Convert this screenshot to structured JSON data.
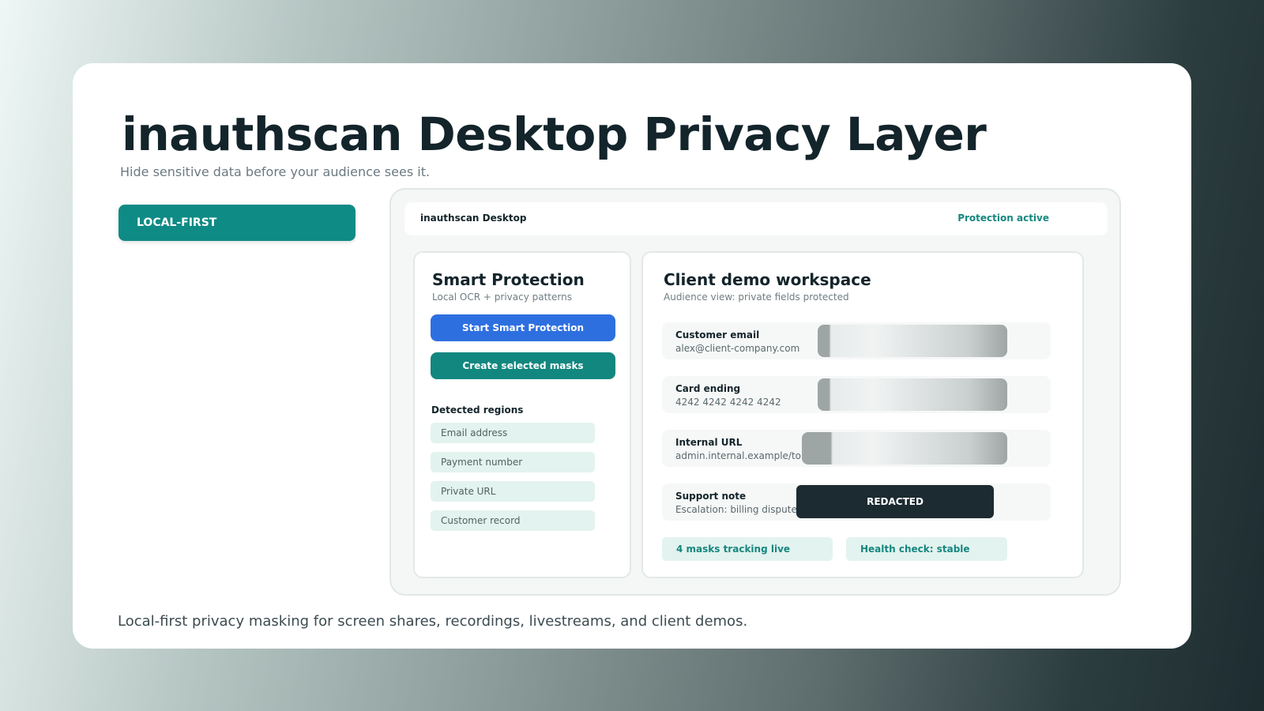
{
  "hero": {
    "title": "inauthscan Desktop Privacy Layer",
    "subtitle": "Hide sensitive data before your audience sees it.",
    "badge": "LOCAL-FIRST",
    "footer": "Local-first privacy masking for screen shares, recordings, livestreams, and client demos."
  },
  "app": {
    "name": "inauthscan Desktop",
    "status": "Protection active"
  },
  "smart_protection": {
    "title": "Smart Protection",
    "subtitle": "Local OCR + privacy patterns",
    "start_button": "Start Smart Protection",
    "create_button": "Create selected masks",
    "regions_label": "Detected regions",
    "regions": [
      "Email address",
      "Payment number",
      "Private URL",
      "Customer record"
    ]
  },
  "workspace": {
    "title": "Client demo workspace",
    "subtitle": "Audience view: private fields protected",
    "fields": [
      {
        "label": "Customer email",
        "value": "alex@client-company.com",
        "mask": "blur"
      },
      {
        "label": "Card ending",
        "value": "4242 4242 4242 4242",
        "mask": "blur"
      },
      {
        "label": "Internal URL",
        "value": "admin.internal.example/token",
        "mask": "blur"
      },
      {
        "label": "Support note",
        "value": "Escalation: billing dispute",
        "mask": "redacted"
      }
    ],
    "redacted_label": "REDACTED",
    "status_pills": [
      "4 masks tracking live",
      "Health check: stable"
    ]
  },
  "colors": {
    "accent_teal": "#0f8b85",
    "accent_blue": "#2e6fe0",
    "dark": "#1c2b31"
  }
}
